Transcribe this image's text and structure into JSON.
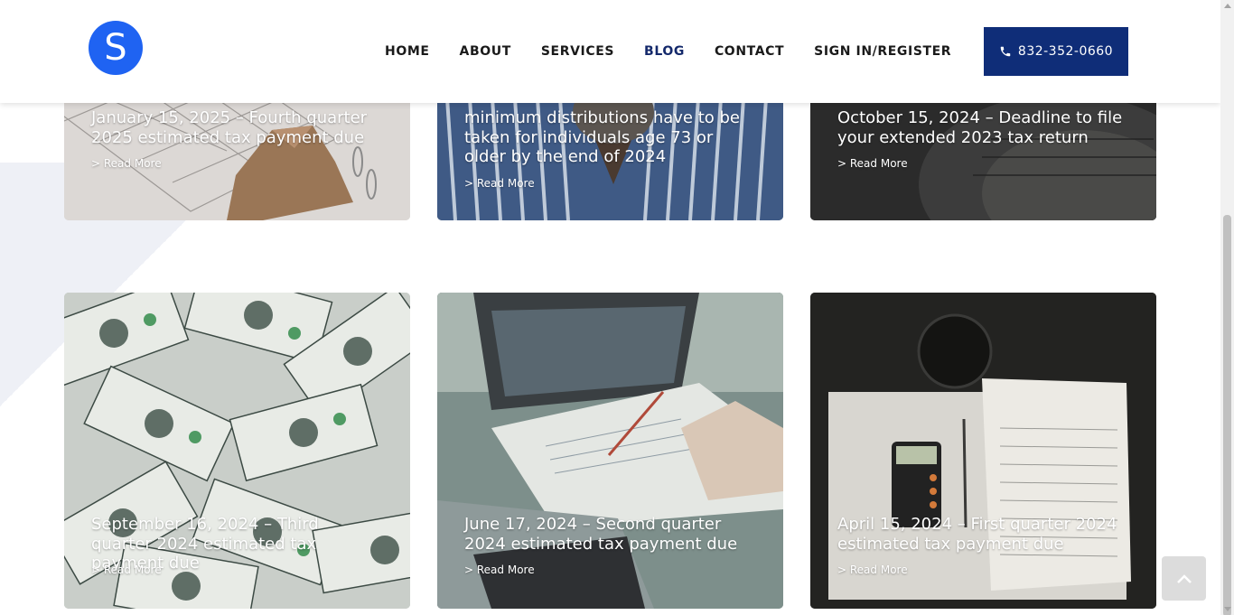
{
  "header": {
    "logo_letter": "S",
    "nav": [
      {
        "label": "HOME",
        "active": false
      },
      {
        "label": "ABOUT",
        "active": false
      },
      {
        "label": "SERVICES",
        "active": false
      },
      {
        "label": "BLOG",
        "active": true
      },
      {
        "label": "CONTACT",
        "active": false
      },
      {
        "label": "SIGN IN/REGISTER",
        "active": false
      }
    ],
    "phone_icon": "phone-icon",
    "phone_label": "832-352-0660"
  },
  "colors": {
    "brand_blue": "#1f63f2",
    "nav_active": "#14296b",
    "phone_button": "#0f2d78"
  },
  "posts": [
    {
      "title": "January 15, 2025 – Fourth quarter 2025 estimated tax payment due",
      "read_more": "> Read More"
    },
    {
      "title": "minimum distributions have to be taken for individuals age 73 or older by the end of 2024",
      "read_more": "> Read More"
    },
    {
      "title": "October 15, 2024 – Deadline to file your extended 2023 tax return",
      "read_more": "> Read More"
    },
    {
      "title": "September 16, 2024 – Third quarter 2024 estimated tax payment due",
      "read_more": "> Read More"
    },
    {
      "title": "June 17, 2024 – Second quarter 2024 estimated tax payment due",
      "read_more": "> Read More"
    },
    {
      "title": "April 15, 2024 – First quarter 2024 estimated tax payment due",
      "read_more": "> Read More"
    }
  ],
  "scroll_top_icon": "chevron-up-icon"
}
